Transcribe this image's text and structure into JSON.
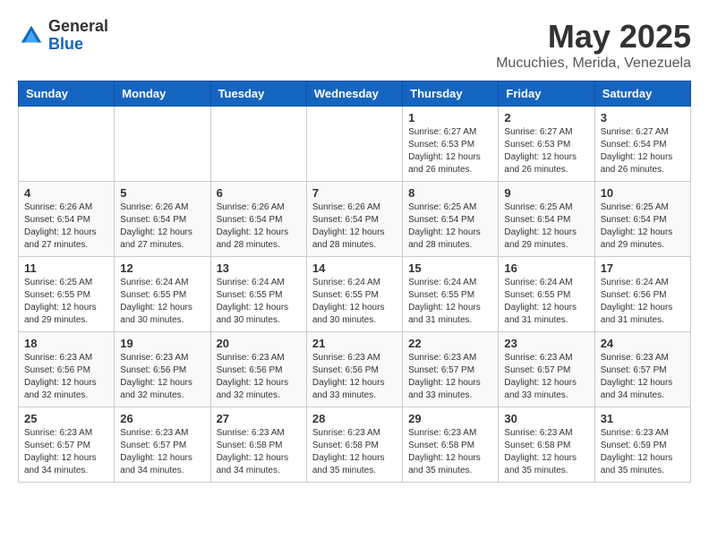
{
  "header": {
    "logo_general": "General",
    "logo_blue": "Blue",
    "month_title": "May 2025",
    "location": "Mucuchies, Merida, Venezuela"
  },
  "weekdays": [
    "Sunday",
    "Monday",
    "Tuesday",
    "Wednesday",
    "Thursday",
    "Friday",
    "Saturday"
  ],
  "weeks": [
    [
      {
        "day": "",
        "sunrise": "",
        "sunset": "",
        "daylight": ""
      },
      {
        "day": "",
        "sunrise": "",
        "sunset": "",
        "daylight": ""
      },
      {
        "day": "",
        "sunrise": "",
        "sunset": "",
        "daylight": ""
      },
      {
        "day": "",
        "sunrise": "",
        "sunset": "",
        "daylight": ""
      },
      {
        "day": "1",
        "sunrise": "6:27 AM",
        "sunset": "6:53 PM",
        "daylight": "12 hours and 26 minutes."
      },
      {
        "day": "2",
        "sunrise": "6:27 AM",
        "sunset": "6:53 PM",
        "daylight": "12 hours and 26 minutes."
      },
      {
        "day": "3",
        "sunrise": "6:27 AM",
        "sunset": "6:54 PM",
        "daylight": "12 hours and 26 minutes."
      }
    ],
    [
      {
        "day": "4",
        "sunrise": "6:26 AM",
        "sunset": "6:54 PM",
        "daylight": "12 hours and 27 minutes."
      },
      {
        "day": "5",
        "sunrise": "6:26 AM",
        "sunset": "6:54 PM",
        "daylight": "12 hours and 27 minutes."
      },
      {
        "day": "6",
        "sunrise": "6:26 AM",
        "sunset": "6:54 PM",
        "daylight": "12 hours and 28 minutes."
      },
      {
        "day": "7",
        "sunrise": "6:26 AM",
        "sunset": "6:54 PM",
        "daylight": "12 hours and 28 minutes."
      },
      {
        "day": "8",
        "sunrise": "6:25 AM",
        "sunset": "6:54 PM",
        "daylight": "12 hours and 28 minutes."
      },
      {
        "day": "9",
        "sunrise": "6:25 AM",
        "sunset": "6:54 PM",
        "daylight": "12 hours and 29 minutes."
      },
      {
        "day": "10",
        "sunrise": "6:25 AM",
        "sunset": "6:54 PM",
        "daylight": "12 hours and 29 minutes."
      }
    ],
    [
      {
        "day": "11",
        "sunrise": "6:25 AM",
        "sunset": "6:55 PM",
        "daylight": "12 hours and 29 minutes."
      },
      {
        "day": "12",
        "sunrise": "6:24 AM",
        "sunset": "6:55 PM",
        "daylight": "12 hours and 30 minutes."
      },
      {
        "day": "13",
        "sunrise": "6:24 AM",
        "sunset": "6:55 PM",
        "daylight": "12 hours and 30 minutes."
      },
      {
        "day": "14",
        "sunrise": "6:24 AM",
        "sunset": "6:55 PM",
        "daylight": "12 hours and 30 minutes."
      },
      {
        "day": "15",
        "sunrise": "6:24 AM",
        "sunset": "6:55 PM",
        "daylight": "12 hours and 31 minutes."
      },
      {
        "day": "16",
        "sunrise": "6:24 AM",
        "sunset": "6:55 PM",
        "daylight": "12 hours and 31 minutes."
      },
      {
        "day": "17",
        "sunrise": "6:24 AM",
        "sunset": "6:56 PM",
        "daylight": "12 hours and 31 minutes."
      }
    ],
    [
      {
        "day": "18",
        "sunrise": "6:23 AM",
        "sunset": "6:56 PM",
        "daylight": "12 hours and 32 minutes."
      },
      {
        "day": "19",
        "sunrise": "6:23 AM",
        "sunset": "6:56 PM",
        "daylight": "12 hours and 32 minutes."
      },
      {
        "day": "20",
        "sunrise": "6:23 AM",
        "sunset": "6:56 PM",
        "daylight": "12 hours and 32 minutes."
      },
      {
        "day": "21",
        "sunrise": "6:23 AM",
        "sunset": "6:56 PM",
        "daylight": "12 hours and 33 minutes."
      },
      {
        "day": "22",
        "sunrise": "6:23 AM",
        "sunset": "6:57 PM",
        "daylight": "12 hours and 33 minutes."
      },
      {
        "day": "23",
        "sunrise": "6:23 AM",
        "sunset": "6:57 PM",
        "daylight": "12 hours and 33 minutes."
      },
      {
        "day": "24",
        "sunrise": "6:23 AM",
        "sunset": "6:57 PM",
        "daylight": "12 hours and 34 minutes."
      }
    ],
    [
      {
        "day": "25",
        "sunrise": "6:23 AM",
        "sunset": "6:57 PM",
        "daylight": "12 hours and 34 minutes."
      },
      {
        "day": "26",
        "sunrise": "6:23 AM",
        "sunset": "6:57 PM",
        "daylight": "12 hours and 34 minutes."
      },
      {
        "day": "27",
        "sunrise": "6:23 AM",
        "sunset": "6:58 PM",
        "daylight": "12 hours and 34 minutes."
      },
      {
        "day": "28",
        "sunrise": "6:23 AM",
        "sunset": "6:58 PM",
        "daylight": "12 hours and 35 minutes."
      },
      {
        "day": "29",
        "sunrise": "6:23 AM",
        "sunset": "6:58 PM",
        "daylight": "12 hours and 35 minutes."
      },
      {
        "day": "30",
        "sunrise": "6:23 AM",
        "sunset": "6:58 PM",
        "daylight": "12 hours and 35 minutes."
      },
      {
        "day": "31",
        "sunrise": "6:23 AM",
        "sunset": "6:59 PM",
        "daylight": "12 hours and 35 minutes."
      }
    ]
  ],
  "labels": {
    "sunrise_prefix": "Sunrise: ",
    "sunset_prefix": "Sunset: ",
    "daylight_prefix": "Daylight: "
  }
}
